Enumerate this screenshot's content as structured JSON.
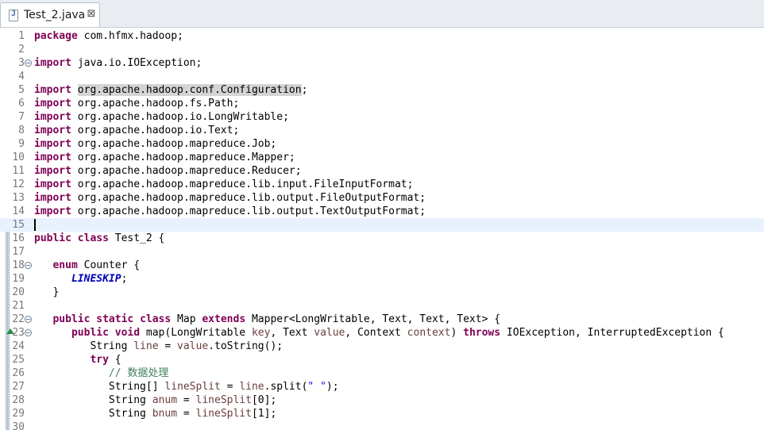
{
  "tab": {
    "title": "Test_2.java",
    "close_glyph": "⊠"
  },
  "icons": {
    "file": "java-file-icon",
    "close": "close-icon",
    "fold": "fold-collapse-icon",
    "override": "override-marker-icon"
  },
  "editor": {
    "current_line": 15,
    "lines": [
      {
        "n": "1",
        "segs": [
          {
            "t": "package",
            "c": "kw"
          },
          {
            "t": " com.hfmx.hadoop;"
          }
        ]
      },
      {
        "n": "2",
        "segs": []
      },
      {
        "n": "3",
        "fold": true,
        "segs": [
          {
            "t": "import",
            "c": "kw"
          },
          {
            "t": " java.io.IOException;"
          }
        ]
      },
      {
        "n": "4",
        "segs": []
      },
      {
        "n": "5",
        "segs": [
          {
            "t": "import",
            "c": "kw"
          },
          {
            "t": " "
          },
          {
            "t": "org.apache.hadoop.conf.Configuration",
            "c": "hl"
          },
          {
            "t": ";"
          }
        ]
      },
      {
        "n": "6",
        "segs": [
          {
            "t": "import",
            "c": "kw"
          },
          {
            "t": " org.apache.hadoop.fs.Path;"
          }
        ]
      },
      {
        "n": "7",
        "segs": [
          {
            "t": "import",
            "c": "kw"
          },
          {
            "t": " org.apache.hadoop.io.LongWritable;"
          }
        ]
      },
      {
        "n": "8",
        "segs": [
          {
            "t": "import",
            "c": "kw"
          },
          {
            "t": " org.apache.hadoop.io.Text;"
          }
        ]
      },
      {
        "n": "9",
        "segs": [
          {
            "t": "import",
            "c": "kw"
          },
          {
            "t": " org.apache.hadoop.mapreduce.Job;"
          }
        ]
      },
      {
        "n": "10",
        "segs": [
          {
            "t": "import",
            "c": "kw"
          },
          {
            "t": " org.apache.hadoop.mapreduce.Mapper;"
          }
        ]
      },
      {
        "n": "11",
        "segs": [
          {
            "t": "import",
            "c": "kw"
          },
          {
            "t": " org.apache.hadoop.mapreduce.Reducer;"
          }
        ]
      },
      {
        "n": "12",
        "segs": [
          {
            "t": "import",
            "c": "kw"
          },
          {
            "t": " org.apache.hadoop.mapreduce.lib.input.FileInputFormat;"
          }
        ]
      },
      {
        "n": "13",
        "segs": [
          {
            "t": "import",
            "c": "kw"
          },
          {
            "t": " org.apache.hadoop.mapreduce.lib.output.FileOutputFormat;"
          }
        ]
      },
      {
        "n": "14",
        "segs": [
          {
            "t": "import",
            "c": "kw"
          },
          {
            "t": " org.apache.hadoop.mapreduce.lib.output.TextOutputFormat;"
          }
        ]
      },
      {
        "n": "15",
        "segs": []
      },
      {
        "n": "16",
        "segs": [
          {
            "t": "public",
            "c": "kw"
          },
          {
            "t": " "
          },
          {
            "t": "class",
            "c": "kw"
          },
          {
            "t": " Test_2 {"
          }
        ]
      },
      {
        "n": "17",
        "segs": []
      },
      {
        "n": "18",
        "fold": true,
        "segs": [
          {
            "t": "   "
          },
          {
            "t": "enum",
            "c": "kw"
          },
          {
            "t": " Counter {"
          }
        ]
      },
      {
        "n": "19",
        "segs": [
          {
            "t": "      "
          },
          {
            "t": "LINESKIP",
            "c": "enum"
          },
          {
            "t": ";"
          }
        ]
      },
      {
        "n": "20",
        "segs": [
          {
            "t": "   }"
          }
        ]
      },
      {
        "n": "21",
        "segs": []
      },
      {
        "n": "22",
        "fold": true,
        "segs": [
          {
            "t": "   "
          },
          {
            "t": "public",
            "c": "kw"
          },
          {
            "t": " "
          },
          {
            "t": "static",
            "c": "kw"
          },
          {
            "t": " "
          },
          {
            "t": "class",
            "c": "kw"
          },
          {
            "t": " Map "
          },
          {
            "t": "extends",
            "c": "kw"
          },
          {
            "t": " Mapper<LongWritable, Text, Text, Text> {"
          }
        ]
      },
      {
        "n": "23",
        "fold": true,
        "override": true,
        "segs": [
          {
            "t": "      "
          },
          {
            "t": "public",
            "c": "kw"
          },
          {
            "t": " "
          },
          {
            "t": "void",
            "c": "kw"
          },
          {
            "t": " map(LongWritable "
          },
          {
            "t": "key",
            "c": "var"
          },
          {
            "t": ", Text "
          },
          {
            "t": "value",
            "c": "var"
          },
          {
            "t": ", Context "
          },
          {
            "t": "context",
            "c": "var"
          },
          {
            "t": ") "
          },
          {
            "t": "throws",
            "c": "kw"
          },
          {
            "t": " IOException, InterruptedException {"
          }
        ]
      },
      {
        "n": "24",
        "segs": [
          {
            "t": "         String "
          },
          {
            "t": "line",
            "c": "var"
          },
          {
            "t": " = "
          },
          {
            "t": "value",
            "c": "var"
          },
          {
            "t": ".toString();"
          }
        ]
      },
      {
        "n": "25",
        "segs": [
          {
            "t": "         "
          },
          {
            "t": "try",
            "c": "kw"
          },
          {
            "t": " {"
          }
        ]
      },
      {
        "n": "26",
        "segs": [
          {
            "t": "            "
          },
          {
            "t": "// 数据处理",
            "c": "cmt"
          }
        ]
      },
      {
        "n": "27",
        "segs": [
          {
            "t": "            String[] "
          },
          {
            "t": "lineSplit",
            "c": "var"
          },
          {
            "t": " = "
          },
          {
            "t": "line",
            "c": "var"
          },
          {
            "t": ".split("
          },
          {
            "t": "\" \"",
            "c": "str"
          },
          {
            "t": ");"
          }
        ]
      },
      {
        "n": "28",
        "segs": [
          {
            "t": "            String "
          },
          {
            "t": "anum",
            "c": "var"
          },
          {
            "t": " = "
          },
          {
            "t": "lineSplit",
            "c": "var"
          },
          {
            "t": "[0];"
          }
        ]
      },
      {
        "n": "29",
        "segs": [
          {
            "t": "            String "
          },
          {
            "t": "bnum",
            "c": "var"
          },
          {
            "t": " = "
          },
          {
            "t": "lineSplit",
            "c": "var"
          },
          {
            "t": "[1];"
          }
        ]
      },
      {
        "n": "30",
        "segs": []
      }
    ]
  }
}
